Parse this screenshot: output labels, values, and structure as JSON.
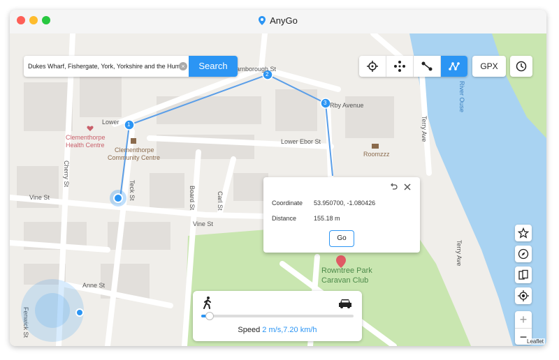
{
  "window": {
    "title": "AnyGo"
  },
  "search": {
    "value": "Dukes Wharf, Fishergate, York, Yorkshire and the Humber",
    "button_label": "Search"
  },
  "toolbar": {
    "modes": [
      {
        "icon": "crosshair-icon",
        "active": false
      },
      {
        "icon": "joystick-icon",
        "active": false
      },
      {
        "icon": "two-spot-route-icon",
        "active": false
      },
      {
        "icon": "multi-spot-route-icon",
        "active": true
      }
    ],
    "gpx_label": "GPX",
    "history_icon": "clock-icon"
  },
  "map": {
    "labels": {
      "lower_st": "Lower",
      "barnborough": "Barnborough St",
      "rby_avenue": "Rby Avenue",
      "lower_ebor": "Lower Ebor St",
      "terry_ave": "Terry Ave",
      "river_ouse": "River Ouse",
      "cherry_st": "Cherry St",
      "clementhorpe_hc": "Clementhorpe",
      "clementhorpe_hc2": "Health Centre",
      "community": "Clementhorpe",
      "community2": "Community Centre",
      "roomzzz": "Roomzzz",
      "vine_st_left": "Vine St",
      "teck_st": "Teck St",
      "board_st": "Board St",
      "carl_st": "Carl St",
      "vine_st_mid": "Vine St",
      "anne_st": "Anne St",
      "fenwick_st": "Fenwick St",
      "terry_ave2": "Terry Ave",
      "rowntree1": "Rowntree Park",
      "rowntree2": "Caravan Club"
    },
    "waypoints": [
      "1",
      "2",
      "3"
    ],
    "attribution": "Leaflet"
  },
  "popup": {
    "coordinate_label": "Coordinate",
    "coordinate_value": "53.950700, -1.080426",
    "distance_label": "Distance",
    "distance_value": "155.18 m",
    "go_label": "Go"
  },
  "speed": {
    "label": "Speed",
    "value": "2 m/s,7.20 km/h",
    "slider_fraction": 0.05,
    "walk_icon": "walk-icon",
    "car_icon": "car-icon"
  },
  "right_tools": [
    "star-icon",
    "compass-icon",
    "device-switch-icon",
    "locate-icon"
  ],
  "zoom": {
    "in_label": "+",
    "out_label": "−"
  },
  "colors": {
    "accent": "#2b95f4",
    "water": "#a9d3f2",
    "park": "#c9e6b0"
  }
}
